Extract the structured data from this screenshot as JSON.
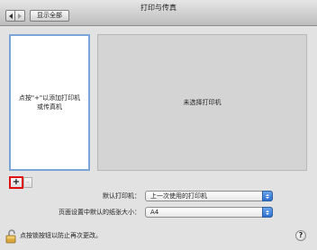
{
  "window": {
    "title": "打印与传真"
  },
  "toolbar": {
    "back_icon": "chevron-left-icon",
    "forward_icon": "chevron-right-icon",
    "show_all_label": "显示全部"
  },
  "printer_list": {
    "hint_line1": "点按\"+\"以添加打印机",
    "hint_line2": "或传真机",
    "add_label": "+",
    "remove_label": "-"
  },
  "detail": {
    "no_printer_label": "未选择打印机"
  },
  "form": {
    "default_printer_label": "默认打印机：",
    "default_printer_value": "上一次使用的打印机",
    "paper_size_label": "页面设置中默认的纸张大小：",
    "paper_size_value": "A4"
  },
  "footer": {
    "lock_text": "点按锁按钮以防止再次更改。",
    "help_label": "?"
  },
  "colors": {
    "highlight_red": "#e01010",
    "selection_blue": "#7aa5d6",
    "popup_blue": "#2c6fd1"
  }
}
